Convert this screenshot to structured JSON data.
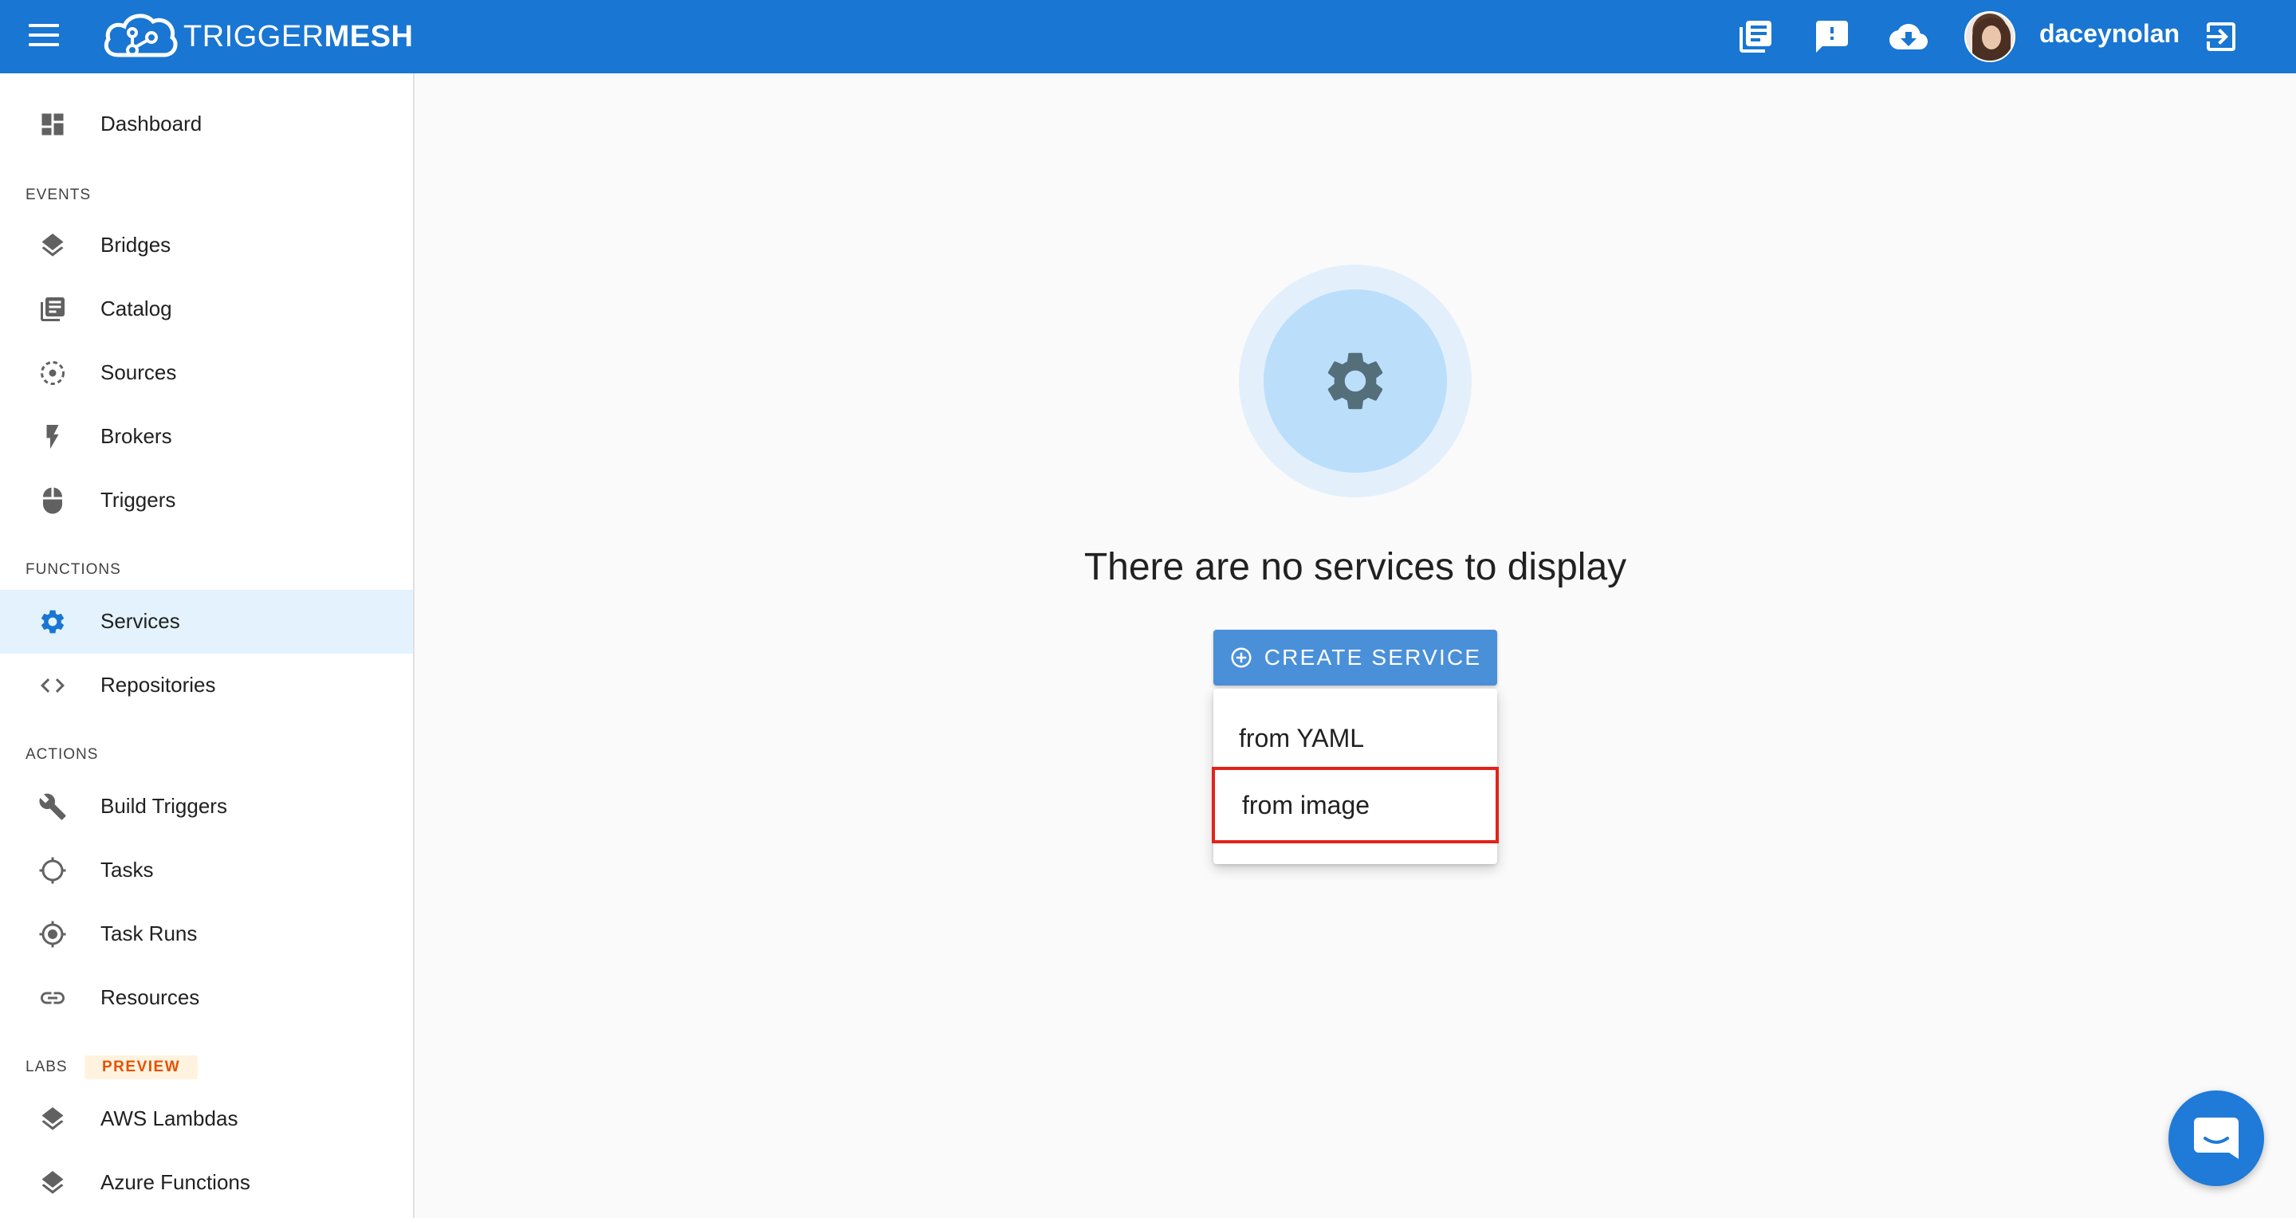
{
  "header": {
    "brand_light": "TRIGGER",
    "brand_bold": "MESH",
    "username": "daceynolan",
    "icons": [
      "menu-icon",
      "docs-icon",
      "feedback-icon",
      "download-icon",
      "avatar",
      "logout-icon"
    ],
    "bar_color": "#1976d2"
  },
  "sidebar": {
    "dashboard": "Dashboard",
    "sections": {
      "events": "EVENTS",
      "functions": "FUNCTIONS",
      "actions": "ACTIONS",
      "labs": "LABS"
    },
    "labs_badge": "PREVIEW",
    "events": [
      {
        "label": "Bridges",
        "icon": "layers-icon"
      },
      {
        "label": "Catalog",
        "icon": "catalog-icon"
      },
      {
        "label": "Sources",
        "icon": "sources-icon"
      },
      {
        "label": "Brokers",
        "icon": "bolt-icon"
      },
      {
        "label": "Triggers",
        "icon": "mouse-icon"
      }
    ],
    "functions": [
      {
        "label": "Services",
        "icon": "gear-icon",
        "active": true
      },
      {
        "label": "Repositories",
        "icon": "code-icon"
      }
    ],
    "actions": [
      {
        "label": "Build Triggers",
        "icon": "wrench-icon"
      },
      {
        "label": "Tasks",
        "icon": "crosshair-icon"
      },
      {
        "label": "Task Runs",
        "icon": "target-icon"
      },
      {
        "label": "Resources",
        "icon": "link-icon"
      }
    ],
    "labs": [
      {
        "label": "AWS Lambdas",
        "icon": "layers-icon"
      },
      {
        "label": "Azure Functions",
        "icon": "layers-icon"
      }
    ]
  },
  "main": {
    "empty_message": "There are no services to display",
    "create_button": "CREATE SERVICE",
    "menu_items": [
      "from YAML",
      "from image"
    ],
    "highlighted_item": "from image",
    "accent": "#4a90d9",
    "highlight_color": "#e2231a"
  }
}
